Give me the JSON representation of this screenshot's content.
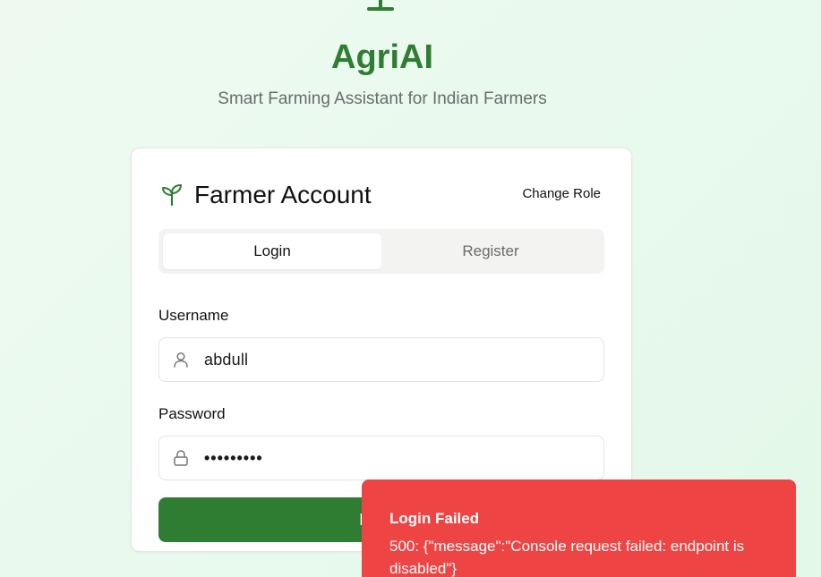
{
  "app": {
    "title": "AgriAI",
    "subtitle": "Smart Farming Assistant for Indian Farmers",
    "logo_icon": "sprout-icon",
    "brand_color": "#2e7d32"
  },
  "card": {
    "title": "Farmer Account",
    "title_icon": "sprout-icon",
    "change_role_label": "Change Role",
    "tabs": [
      {
        "label": "Login",
        "active": true
      },
      {
        "label": "Register",
        "active": false
      }
    ],
    "username": {
      "label": "Username",
      "icon": "user-icon",
      "value": "abdull"
    },
    "password": {
      "label": "Password",
      "icon": "lock-icon",
      "value": "•••••••••"
    },
    "submit_label": "Login"
  },
  "toast": {
    "title": "Login Failed",
    "message": "500: {\"message\":\"Console request failed: endpoint is disabled\"}",
    "color": "#ef4444"
  }
}
